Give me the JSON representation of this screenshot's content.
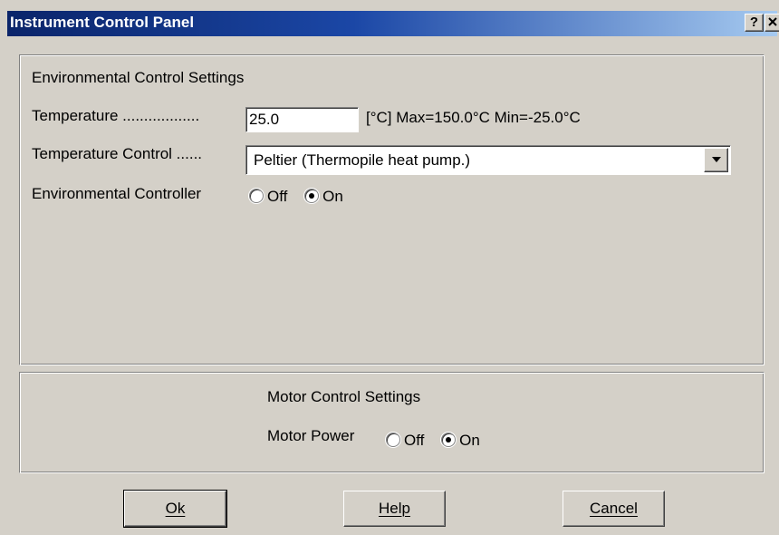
{
  "window": {
    "title": "Instrument Control Panel",
    "help_button": "?",
    "close_icon": "close-icon"
  },
  "environment": {
    "section_title": "Environmental Control Settings",
    "temperature_label": "Temperature ..................",
    "temperature_value": "25.0",
    "temperature_range": "[°C] Max=150.0°C  Min=-25.0°C",
    "temperature_control_label": "Temperature Control ......",
    "temperature_control_value": "Peltier (Thermopile heat pump.)",
    "controller_label": "Environmental Controller",
    "controller_options": {
      "off": "Off",
      "on": "On"
    },
    "controller_selected": "On"
  },
  "motor": {
    "section_title": "Motor Control Settings",
    "power_label": "Motor Power",
    "power_options": {
      "off": "Off",
      "on": "On"
    },
    "power_selected": "On"
  },
  "buttons": {
    "ok": "Ok",
    "help": "Help",
    "cancel": "Cancel"
  },
  "colors": {
    "face": "#d4d0c8",
    "title_start": "#0a246a",
    "title_end": "#a6caf0"
  }
}
